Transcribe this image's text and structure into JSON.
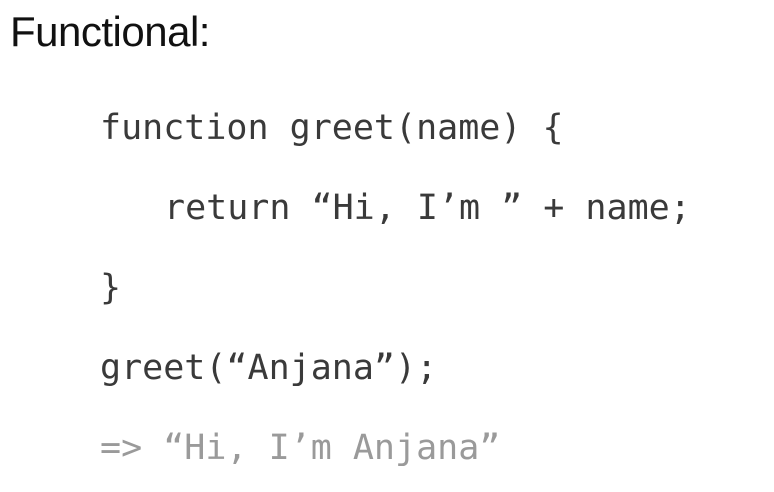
{
  "title": "Functional:",
  "code_lines": [
    "function greet(name) {",
    "return “Hi, I’m ” + name;",
    "}",
    "greet(“Anjana”);",
    "=> “Hi, I’m Anjana”"
  ],
  "colors": {
    "code": "#3a3a3a",
    "output": "#9a9a9a",
    "heading": "#111111",
    "background": "#ffffff"
  }
}
